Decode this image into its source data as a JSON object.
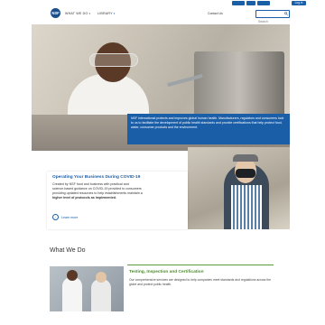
{
  "utility": {
    "login_label": "Log in",
    "colors": {
      "bar_accent": "#1b5ea8"
    }
  },
  "header": {
    "logo_text": "NSF",
    "nav": [
      {
        "label": "WHAT WE DO"
      },
      {
        "label": "LIBRARY"
      }
    ],
    "quick_label": "Contact Us",
    "search_placeholder": "Search"
  },
  "hero": {
    "caption": "NSF International protects and improves global human health. Manufacturers, regulators and consumers look to us to facilitate the development of public health standards and provide certifications that help protect food, water, consumer products and the environment."
  },
  "covid": {
    "title": "Operating Your Business During COVID-19",
    "body": "Created by NSF food and business with practical and",
    "body2": "science-based guidance on COVID-19 provided to consumers",
    "body3": "providing updated resources to help establishments maintain a",
    "body_bold": "higher level of protocols as implemented.",
    "learn_more": "Learn more"
  },
  "what_we_do": {
    "title": "What We Do",
    "items": [
      {
        "title": "Testing, Inspection and Certification",
        "body": "Our comprehensive services are designed to help companies meet standards and regulations across the globe and protect public health."
      }
    ]
  },
  "colors": {
    "brand_blue": "#1b5ea8",
    "green_accent": "#4d8c2c"
  }
}
